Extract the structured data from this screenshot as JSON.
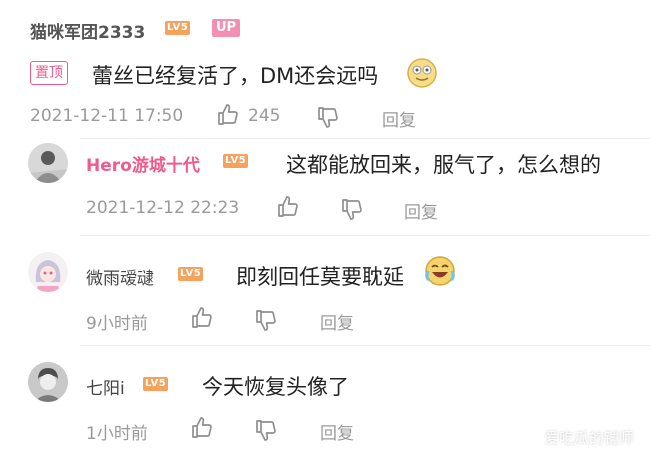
{
  "main_comment": {
    "username": "猫咪军团2333",
    "level": "LV5",
    "up_badge": "UP",
    "pinned_label": "置顶",
    "text": "蕾丝已经复活了，DM还会远吗",
    "timestamp": "2021-12-11 17:50",
    "like_count": "245",
    "reply_label": "回复"
  },
  "replies": [
    {
      "username": "Hero游城十代",
      "level": "LV5",
      "text": "这都能放回来，服气了，怎么想的",
      "timestamp": "2021-12-12 22:23",
      "reply_label": "回复"
    },
    {
      "username": "微雨叆叇",
      "level": "LV5",
      "text": "即刻回任莫要耽延",
      "timestamp": "9小时前",
      "reply_label": "回复"
    },
    {
      "username": "七阳i",
      "level": "LV5",
      "text": "今天恢复头像了",
      "timestamp": "1小时前",
      "reply_label": "回复"
    }
  ],
  "watermark": "爱吃瓜的铠师",
  "colors": {
    "accent_pink": "#f15b8c",
    "level_badge": "#f5a25d",
    "meta_gray": "#9a9a9a"
  },
  "icons": [
    "thumb-up-icon",
    "thumb-down-icon",
    "smile-emoji-icon",
    "laugh-tears-emoji-icon"
  ]
}
